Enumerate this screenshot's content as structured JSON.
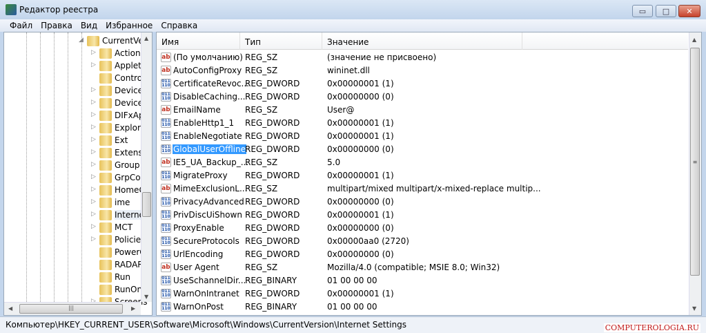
{
  "window": {
    "title": "Редактор реестра",
    "minimize": "▭",
    "maximize": "□",
    "close": "✕"
  },
  "menu": [
    "Файл",
    "Правка",
    "Вид",
    "Избранное",
    "Справка"
  ],
  "tree": {
    "parent": "CurrentVer",
    "items": [
      {
        "label": "Action",
        "expandable": true
      },
      {
        "label": "Applets",
        "expandable": true
      },
      {
        "label": "Contro",
        "expandable": false
      },
      {
        "label": "Device",
        "expandable": true
      },
      {
        "label": "Device",
        "expandable": true
      },
      {
        "label": "DIFxAp",
        "expandable": true
      },
      {
        "label": "Explore",
        "expandable": true
      },
      {
        "label": "Ext",
        "expandable": true
      },
      {
        "label": "Extensio",
        "expandable": true
      },
      {
        "label": "Group I",
        "expandable": true
      },
      {
        "label": "GrpCor",
        "expandable": true
      },
      {
        "label": "HomeG",
        "expandable": true
      },
      {
        "label": "ime",
        "expandable": true
      },
      {
        "label": "Interne",
        "expandable": true,
        "selected": true
      },
      {
        "label": "MCT",
        "expandable": true
      },
      {
        "label": "Policies",
        "expandable": true
      },
      {
        "label": "PowerC",
        "expandable": false
      },
      {
        "label": "RADAR",
        "expandable": false
      },
      {
        "label": "Run",
        "expandable": false
      },
      {
        "label": "RunOn",
        "expandable": false
      },
      {
        "label": "Screens",
        "expandable": true
      }
    ]
  },
  "columns": {
    "name": "Имя",
    "type": "Тип",
    "value": "Значение"
  },
  "rows": [
    {
      "name": "(По умолчанию)",
      "type": "REG_SZ",
      "value": "(значение не присвоено)",
      "icon": "string"
    },
    {
      "name": "AutoConfigProxy",
      "type": "REG_SZ",
      "value": "wininet.dll",
      "icon": "string"
    },
    {
      "name": "CertificateRevoc...",
      "type": "REG_DWORD",
      "value": "0x00000001 (1)",
      "icon": "binary"
    },
    {
      "name": "DisableCaching...",
      "type": "REG_DWORD",
      "value": "0x00000000 (0)",
      "icon": "binary"
    },
    {
      "name": "EmailName",
      "type": "REG_SZ",
      "value": "User@",
      "icon": "string"
    },
    {
      "name": "EnableHttp1_1",
      "type": "REG_DWORD",
      "value": "0x00000001 (1)",
      "icon": "binary"
    },
    {
      "name": "EnableNegotiate",
      "type": "REG_DWORD",
      "value": "0x00000001 (1)",
      "icon": "binary"
    },
    {
      "name": "GlobalUserOffline",
      "type": "REG_DWORD",
      "value": "0x00000000 (0)",
      "icon": "binary",
      "selected": true
    },
    {
      "name": "IE5_UA_Backup_...",
      "type": "REG_SZ",
      "value": "5.0",
      "icon": "string"
    },
    {
      "name": "MigrateProxy",
      "type": "REG_DWORD",
      "value": "0x00000001 (1)",
      "icon": "binary"
    },
    {
      "name": "MimeExclusionL...",
      "type": "REG_SZ",
      "value": "multipart/mixed multipart/x-mixed-replace multip...",
      "icon": "string"
    },
    {
      "name": "PrivacyAdvanced",
      "type": "REG_DWORD",
      "value": "0x00000000 (0)",
      "icon": "binary"
    },
    {
      "name": "PrivDiscUiShown",
      "type": "REG_DWORD",
      "value": "0x00000001 (1)",
      "icon": "binary"
    },
    {
      "name": "ProxyEnable",
      "type": "REG_DWORD",
      "value": "0x00000000 (0)",
      "icon": "binary"
    },
    {
      "name": "SecureProtocols",
      "type": "REG_DWORD",
      "value": "0x00000aa0 (2720)",
      "icon": "binary"
    },
    {
      "name": "UrlEncoding",
      "type": "REG_DWORD",
      "value": "0x00000000 (0)",
      "icon": "binary"
    },
    {
      "name": "User Agent",
      "type": "REG_SZ",
      "value": "Mozilla/4.0 (compatible; MSIE 8.0; Win32)",
      "icon": "string"
    },
    {
      "name": "UseSchannelDir...",
      "type": "REG_BINARY",
      "value": "01 00 00 00",
      "icon": "binary"
    },
    {
      "name": "WarnOnIntranet",
      "type": "REG_DWORD",
      "value": "0x00000001 (1)",
      "icon": "binary"
    },
    {
      "name": "WarnOnPost",
      "type": "REG_BINARY",
      "value": "01 00 00 00",
      "icon": "binary"
    }
  ],
  "icons": {
    "string": "ab",
    "binary": "011\n110"
  },
  "status": {
    "path": "Компьютер\\HKEY_CURRENT_USER\\Software\\Microsoft\\Windows\\CurrentVersion\\Internet Settings"
  },
  "watermark": "COMPUTEROLOGIA.RU"
}
